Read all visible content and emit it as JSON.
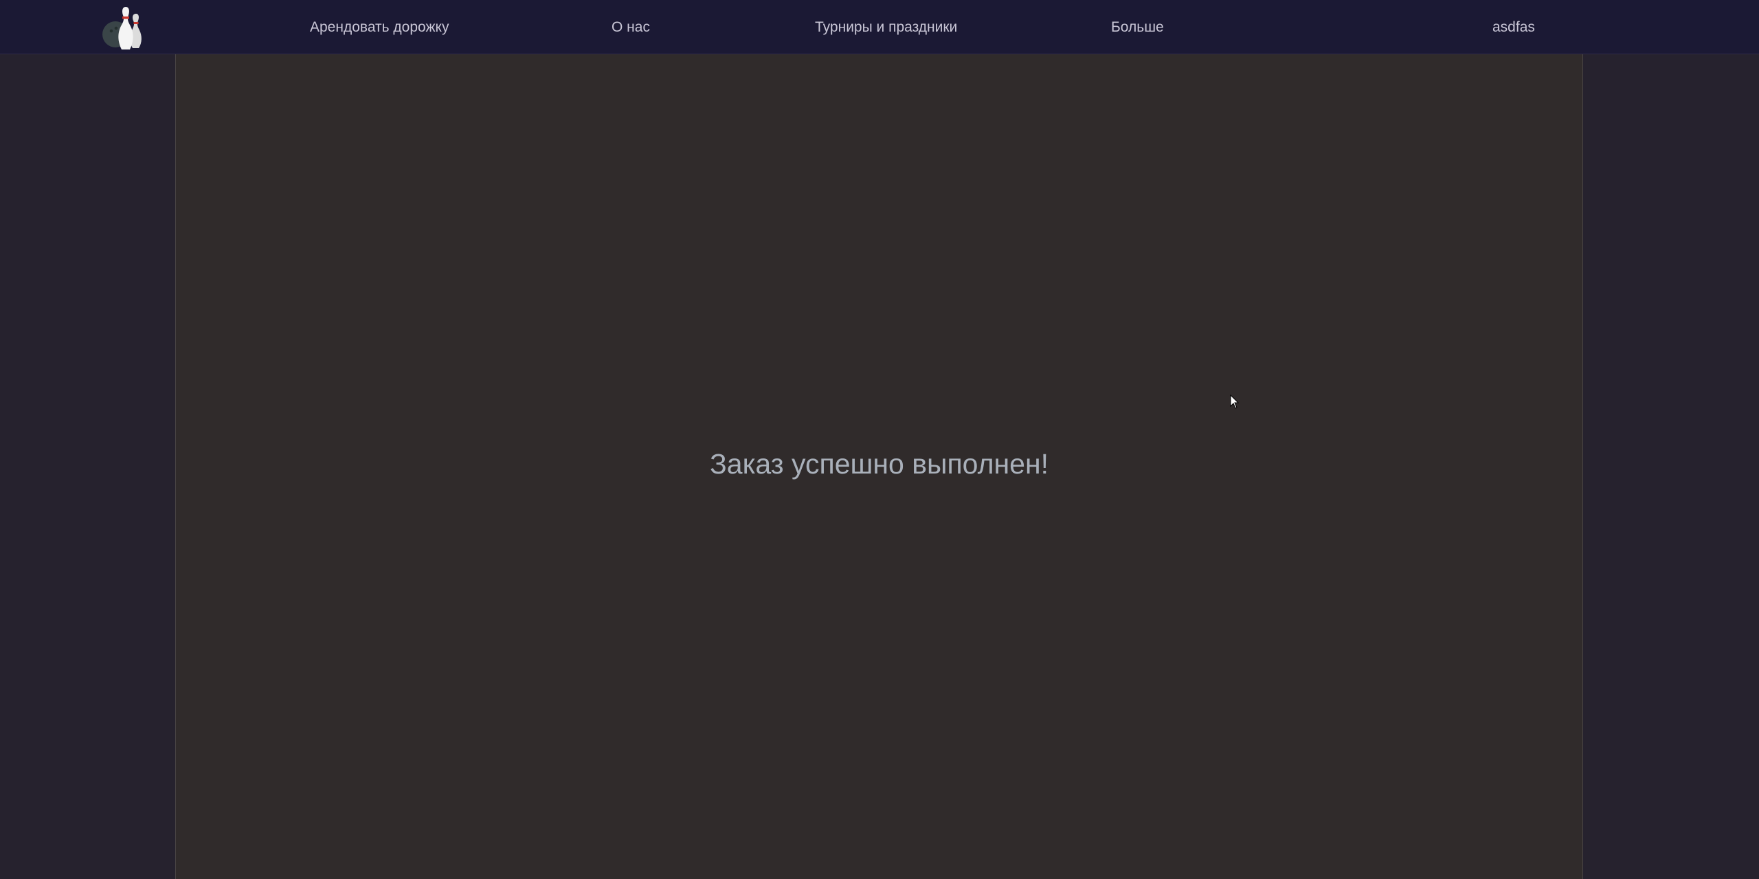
{
  "nav": {
    "logo_icon": "bowling-pins-logo-icon",
    "links": [
      {
        "label": "Арендовать дорожку"
      },
      {
        "label": "О нас"
      },
      {
        "label": "Турниры и праздники"
      },
      {
        "label": "Больше"
      }
    ],
    "user_label": "asdfas"
  },
  "main": {
    "message": "Заказ успешно выполнен!"
  },
  "colors": {
    "navbar_bg": "#1b1934",
    "page_bg": "#26222e",
    "content_bg": "#302b2b",
    "nav_text": "#c9c6d6",
    "message_text": "#a9b0ba"
  }
}
